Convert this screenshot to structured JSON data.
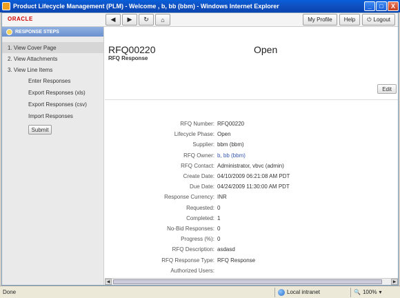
{
  "window": {
    "title": "Product Lifecycle Management (PLM) - Welcome , b, bb (bbm) - Windows Internet Explorer",
    "min_label": "_",
    "max_label": "□",
    "close_label": "X"
  },
  "header": {
    "logo": "ORACLE",
    "nav": {
      "back": "◀",
      "forward": "▶",
      "refresh": "↻",
      "home": "⌂"
    },
    "my_profile": "My Profile",
    "help": "Help",
    "logout": "Logout",
    "logout_icon": "⏻"
  },
  "sidebar": {
    "title": "RESPONSE STEPS",
    "steps": [
      {
        "label": "1. View Cover Page"
      },
      {
        "label": "2. View Attachments"
      },
      {
        "label": "3. View Line Items"
      }
    ],
    "substeps": [
      {
        "label": "Enter Responses"
      },
      {
        "label": "Export Responses (xls)"
      },
      {
        "label": "Export Responses (csv)"
      },
      {
        "label": "Import Responses"
      }
    ],
    "submit_label": "Submit"
  },
  "main": {
    "rfq_id": "RFQ00220",
    "rfq_subtitle": "RFQ Response",
    "status": "Open",
    "edit_label": "Edit",
    "fields": [
      {
        "label": "RFQ Number:",
        "value": "RFQ00220"
      },
      {
        "label": "Lifecycle Phase:",
        "value": "Open"
      },
      {
        "label": "Supplier:",
        "value": "bbm (bbm)"
      },
      {
        "label": "RFQ Owner:",
        "value": "b, bb (bbm)"
      },
      {
        "label": "RFQ Contact:",
        "value": "Administrator, vbvc (admin)"
      },
      {
        "label": "Create Date:",
        "value": "04/10/2009 06:21:08 AM PDT"
      },
      {
        "label": "Due Date:",
        "value": "04/24/2009 11:30:00 AM PDT"
      },
      {
        "label": "Response Currency:",
        "value": "INR"
      },
      {
        "label": "Requested:",
        "value": "0"
      },
      {
        "label": "Completed:",
        "value": "1"
      },
      {
        "label": "No-Bid Responses:",
        "value": "0"
      },
      {
        "label": "Progress (%):",
        "value": "0"
      },
      {
        "label": "RFQ Description:",
        "value": "asdasd"
      },
      {
        "label": "RFQ Response Type:",
        "value": "RFQ Response"
      },
      {
        "label": "Authorized Users:",
        "value": ""
      }
    ]
  },
  "statusbar": {
    "text": "Done",
    "zone": "Local intranet",
    "zoom": "100%"
  },
  "colors": {
    "titlebar": "#0a5fd8",
    "steps_header": "#7a9dd8",
    "link": "#3355aa",
    "oracle_red": "#cc0000"
  }
}
